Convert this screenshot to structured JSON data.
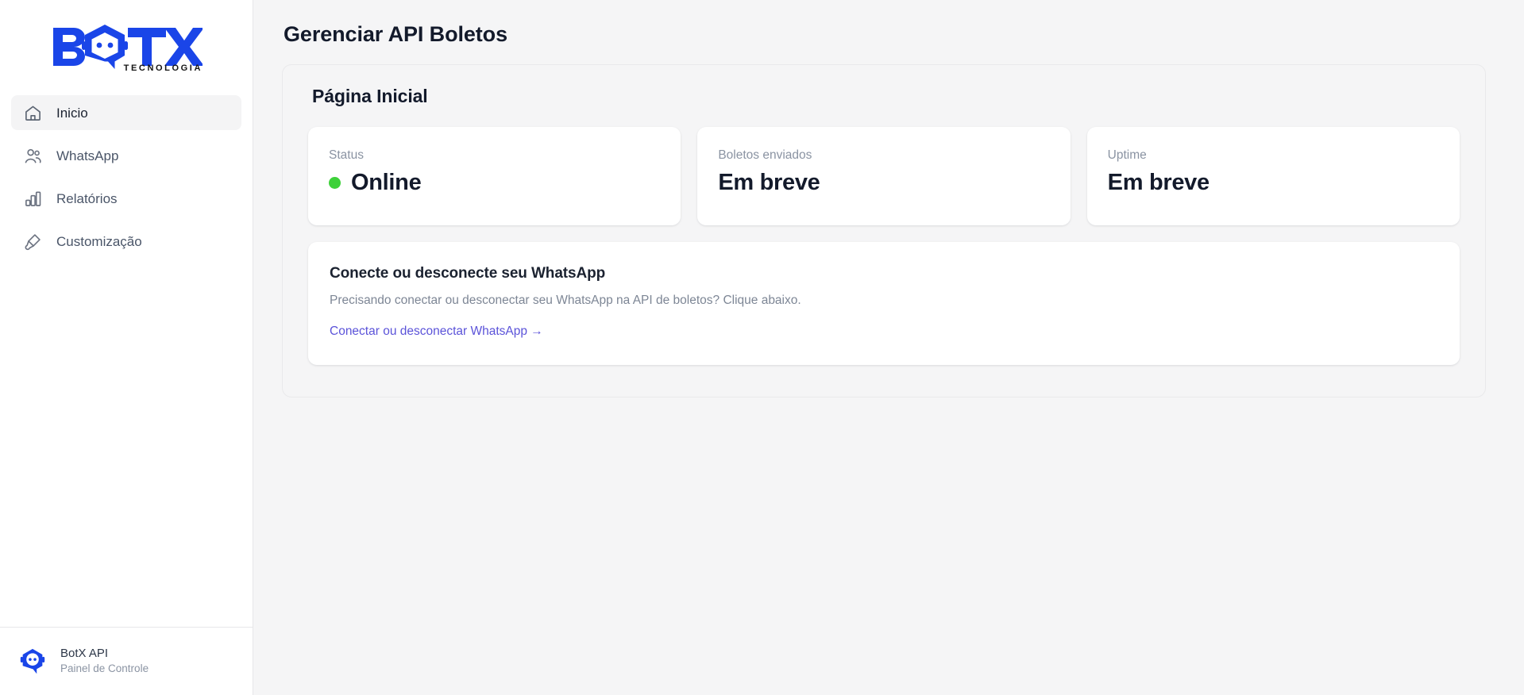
{
  "brand": {
    "logo_text": "BOTX",
    "logo_subtext": "TECNOLOGIA",
    "logo_color": "#1a45e8",
    "icon": "botx-robot-hexagon-logo"
  },
  "sidebar": {
    "items": [
      {
        "label": "Inicio",
        "icon": "home-icon",
        "active": true
      },
      {
        "label": "WhatsApp",
        "icon": "users-icon",
        "active": false
      },
      {
        "label": "Relatórios",
        "icon": "bar-chart-icon",
        "active": false
      },
      {
        "label": "Customização",
        "icon": "paint-brush-icon",
        "active": false
      }
    ],
    "footer": {
      "title": "BotX API",
      "subtitle": "Painel de Controle",
      "icon": "botx-hexagon-icon"
    }
  },
  "header": {
    "title": "Gerenciar API Boletos"
  },
  "panel": {
    "title": "Página Inicial",
    "cards": [
      {
        "label": "Status",
        "value": "Online",
        "has_dot": true,
        "dot_color": "#3ed13a"
      },
      {
        "label": "Boletos enviados",
        "value": "Em breve",
        "has_dot": false
      },
      {
        "label": "Uptime",
        "value": "Em breve",
        "has_dot": false
      }
    ],
    "whatsapp_card": {
      "title": "Conecte ou desconecte seu WhatsApp",
      "description": "Precisando conectar ou desconectar seu WhatsApp na API de boletos? Clique abaixo.",
      "link_label": "Conectar ou desconectar WhatsApp →",
      "link_color": "#5b53d9"
    }
  }
}
